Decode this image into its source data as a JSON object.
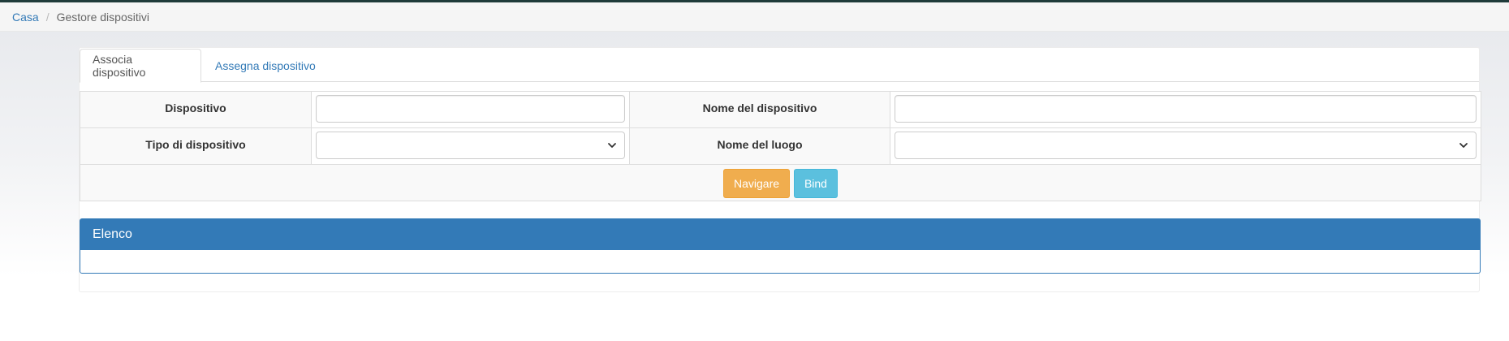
{
  "breadcrumb": {
    "home": "Casa",
    "separator": "/",
    "current": "Gestore dispositivi"
  },
  "tabs": [
    {
      "label": "Associa dispositivo",
      "active": true
    },
    {
      "label": "Assegna dispositivo",
      "active": false
    }
  ],
  "form": {
    "device_label": "Dispositivo",
    "device_value": "",
    "device_name_label": "Nome del dispositivo",
    "device_name_value": "",
    "device_type_label": "Tipo di dispositivo",
    "device_type_selected": "",
    "location_name_label": "Nome del luogo",
    "location_name_selected": ""
  },
  "actions": {
    "navigate_label": "Navigare",
    "bind_label": "Bind"
  },
  "list_panel": {
    "title": "Elenco"
  },
  "colors": {
    "primary": "#337ab7",
    "warning": "#f0ad4e",
    "info": "#5bc0de",
    "top_strip": "#1f3b3a"
  },
  "icons": {
    "select_arrow": "chevron-down-icon"
  }
}
